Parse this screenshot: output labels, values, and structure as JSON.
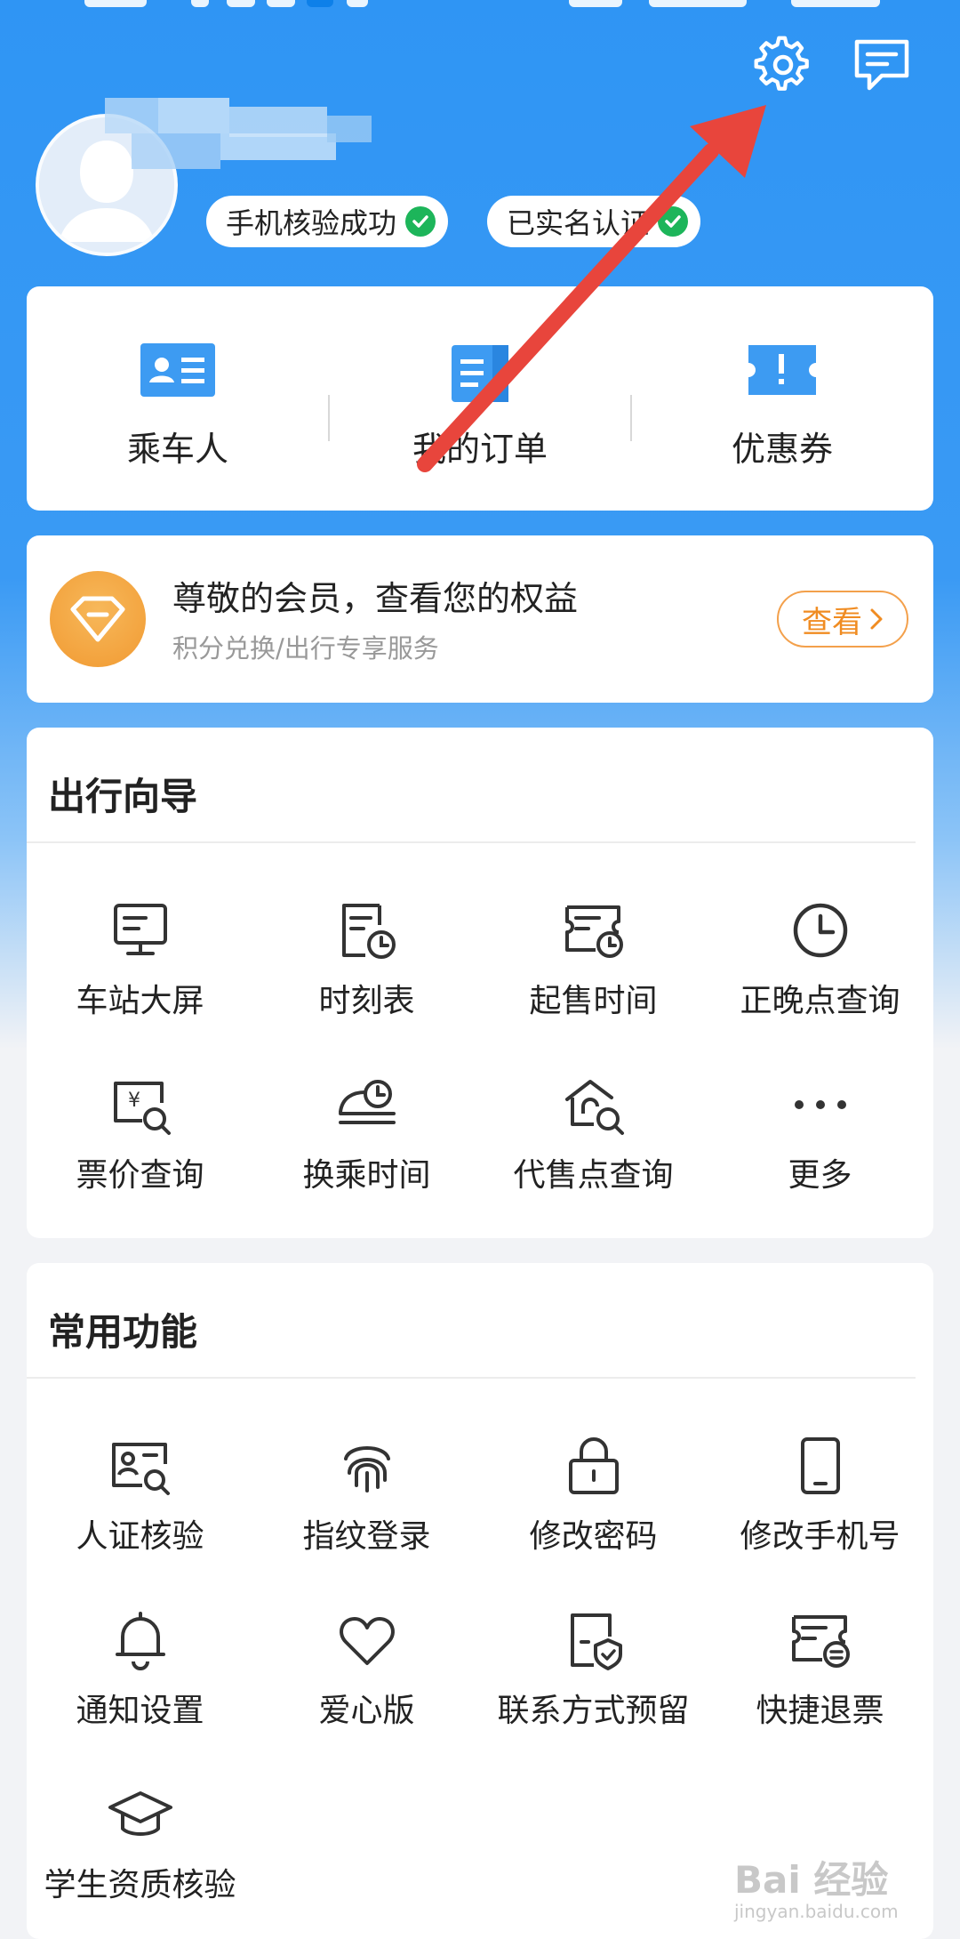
{
  "header": {
    "badges": [
      "手机核验成功",
      "已实名认证"
    ]
  },
  "quick_actions": [
    {
      "label": "乘车人",
      "icon": "passenger-card-icon"
    },
    {
      "label": "我的订单",
      "icon": "order-list-icon"
    },
    {
      "label": "优惠券",
      "icon": "coupon-icon"
    }
  ],
  "member": {
    "title": "尊敬的会员，查看您的权益",
    "subtitle": "积分兑换/出行专享服务",
    "button": "查看"
  },
  "travel_guide": {
    "title": "出行向导",
    "items": [
      {
        "label": "车站大屏",
        "icon": "monitor-icon"
      },
      {
        "label": "时刻表",
        "icon": "timetable-icon"
      },
      {
        "label": "起售时间",
        "icon": "ticket-clock-icon"
      },
      {
        "label": "正晚点查询",
        "icon": "clock-icon"
      },
      {
        "label": "票价查询",
        "icon": "price-search-icon"
      },
      {
        "label": "换乘时间",
        "icon": "transfer-time-icon"
      },
      {
        "label": "代售点查询",
        "icon": "agency-search-icon"
      },
      {
        "label": "更多",
        "icon": "more-dots-icon"
      }
    ]
  },
  "common_functions": {
    "title": "常用功能",
    "items": [
      {
        "label": "人证核验",
        "icon": "id-verify-icon"
      },
      {
        "label": "指纹登录",
        "icon": "fingerprint-icon"
      },
      {
        "label": "修改密码",
        "icon": "lock-icon"
      },
      {
        "label": "修改手机号",
        "icon": "phone-icon"
      },
      {
        "label": "通知设置",
        "icon": "bell-icon"
      },
      {
        "label": "爱心版",
        "icon": "heart-icon"
      },
      {
        "label": "联系方式预留",
        "icon": "contact-shield-icon"
      },
      {
        "label": "快捷退票",
        "icon": "refund-ticket-icon"
      },
      {
        "label": "学生资质核验",
        "icon": "graduation-cap-icon"
      }
    ]
  },
  "watermark": {
    "text": "Bai 经验",
    "url_text": "jingyan.baidu.com"
  },
  "colors": {
    "primary": "#2f95f4",
    "accent_orange": "#f08c22",
    "success_green": "#1db55a",
    "arrow_red": "#e8453c"
  }
}
